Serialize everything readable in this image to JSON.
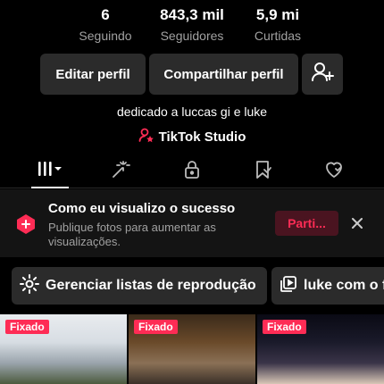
{
  "stats": [
    {
      "value": "6",
      "label": "Seguindo"
    },
    {
      "value": "843,3 mil",
      "label": "Seguidores"
    },
    {
      "value": "5,9 mi",
      "label": "Curtidas"
    }
  ],
  "actions": {
    "edit_label": "Editar perfil",
    "share_label": "Compartilhar perfil",
    "add_friend_icon": "add-user-icon"
  },
  "bio": "dedicado a luccas gi e luke",
  "studio_link": "TikTok Studio",
  "tabs": [
    {
      "name": "videos",
      "icon": "grid-icon",
      "active": true
    },
    {
      "name": "likes-posts",
      "icon": "magic-wand-icon"
    },
    {
      "name": "private",
      "icon": "lock-icon"
    },
    {
      "name": "saved",
      "icon": "bookmark-icon"
    },
    {
      "name": "liked",
      "icon": "heart-icon"
    }
  ],
  "banner": {
    "title": "Como eu visualizo o sucesso",
    "subtitle": "Publique fotos para aumentar as visualizações.",
    "cta_label": "Parti...",
    "accent": "#fe2c55"
  },
  "playlists": [
    {
      "label": "Gerenciar listas de reprodução",
      "icon": "gear-icon"
    },
    {
      "label": "luke com o f",
      "icon": "playlist-icon"
    }
  ],
  "thumbnails": [
    {
      "badge": "Fixado"
    },
    {
      "badge": "Fixado"
    },
    {
      "badge": "Fixado"
    }
  ],
  "colors": {
    "background": "#000000",
    "button_bg": "#2b2b2b",
    "accent": "#fe2c55",
    "muted_text": "#a1a1a1"
  }
}
